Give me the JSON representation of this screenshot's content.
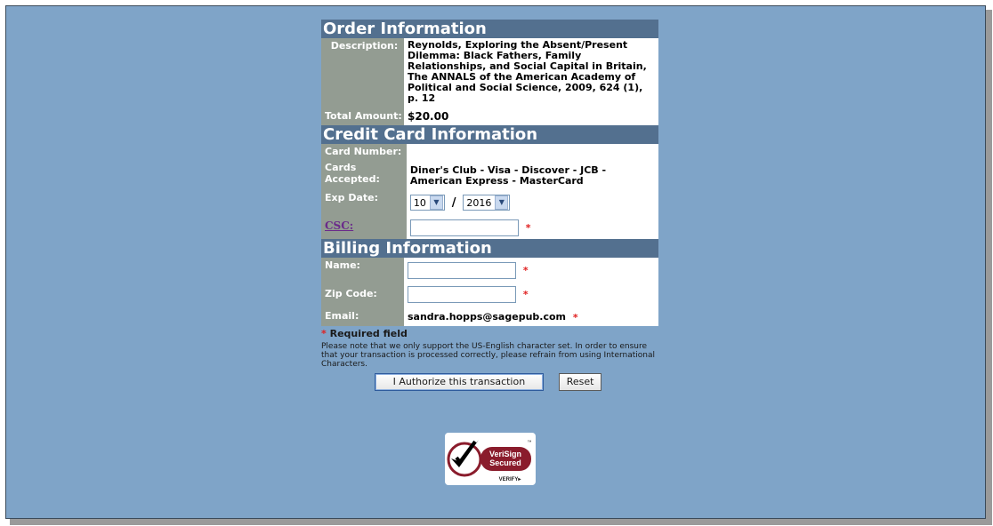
{
  "order": {
    "header": "Order Information",
    "description_label": "Description:",
    "description": "Reynolds, Exploring the Absent/Present Dilemma: Black Fathers, Family Relationships, and Social Capital in Britain, The ANNALS of the American Academy of Political and Social Science, 2009, 624 (1), p. 12",
    "total_label": "Total Amount:",
    "total": "$20.00"
  },
  "card": {
    "header": "Credit Card Information",
    "number_label": "Card Number:",
    "accepted_label": "Cards Accepted:",
    "accepted": "Diner's Club - Visa - Discover - JCB - American Express - MasterCard",
    "exp_label": "Exp Date:",
    "exp_month": "10",
    "exp_year": "2016",
    "exp_separator": "/",
    "csc_label": "CSC:",
    "csc_value": ""
  },
  "billing": {
    "header": "Billing Information",
    "name_label": "Name:",
    "name_value": "",
    "zip_label": "Zip Code:",
    "zip_value": "",
    "email_label": "Email:",
    "email": "sandra.hopps@sagepub.com"
  },
  "required_star": "*",
  "required_text": "Required field",
  "note": "Please note that we only support the US-English character set. In order to ensure that your transaction is processed correctly, please refrain from using International Characters.",
  "buttons": {
    "authorize": "I Authorize this transaction",
    "reset": "Reset"
  },
  "badge": {
    "line1": "VeriSign",
    "line2": "Secured",
    "verify": "VERIFY▸",
    "tm": "™"
  },
  "colors": {
    "background": "#7fa4c8",
    "section_header": "#53708f",
    "label_cell": "#939c92",
    "required": "#e02020"
  }
}
